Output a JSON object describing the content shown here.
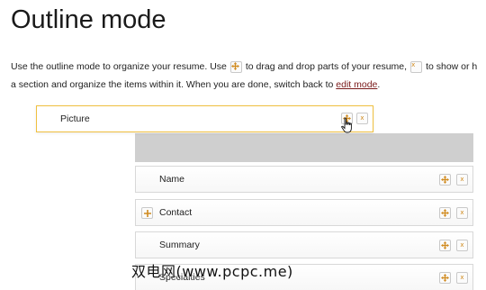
{
  "page": {
    "title": "Outline mode"
  },
  "intro": {
    "text_part1": "Use the outline mode to organize your resume. Use",
    "text_part2": "to drag and drop parts of your resume,",
    "text_part3": "to show or h",
    "text_line2": "a section and organize the items within it. When you are done, switch back to",
    "edit_link": "edit mode",
    "text_end": "."
  },
  "dragged_item": {
    "label": "Picture"
  },
  "sections": [
    {
      "label": "Name",
      "expandable": false
    },
    {
      "label": "Contact",
      "expandable": true
    },
    {
      "label": "Summary",
      "expandable": false
    },
    {
      "label": "Specialties",
      "expandable": false
    }
  ],
  "icons": {
    "drag": "move-icon",
    "close": "close-icon",
    "expand": "plus-icon",
    "cursor": "hand-cursor-icon"
  },
  "colors": {
    "accent": "#d08a1e",
    "drag_border": "#f0c040",
    "placeholder": "#cfcfcf",
    "link": "#7a1a1a"
  },
  "close_glyph": "x",
  "watermark": "双电网(www.pcpc.me)"
}
